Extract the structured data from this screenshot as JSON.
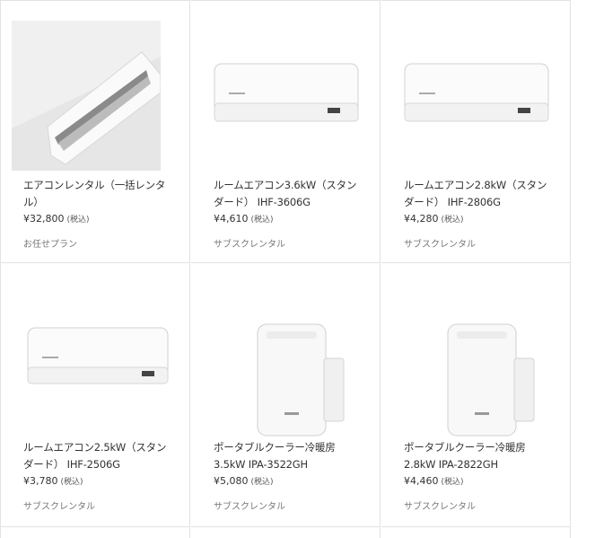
{
  "products": [
    {
      "title": "エアコンレンタル（一括レンタル）",
      "price": "¥32,800",
      "tax": "(税込)",
      "plan": "お任せプラン",
      "icon": "mounted-aircon-photo"
    },
    {
      "title": "ルームエアコン3.6kW（スタンダード） IHF-3606G",
      "price": "¥4,610",
      "tax": "(税込)",
      "plan": "サブスクレンタル",
      "icon": "wall-aircon"
    },
    {
      "title": "ルームエアコン2.8kW（スタンダード） IHF-2806G",
      "price": "¥4,280",
      "tax": "(税込)",
      "plan": "サブスクレンタル",
      "icon": "wall-aircon"
    },
    {
      "title": "ルームエアコン2.5kW（スタンダード） IHF-2506G",
      "price": "¥3,780",
      "tax": "(税込)",
      "plan": "サブスクレンタル",
      "icon": "wall-aircon"
    },
    {
      "title": "ポータブルクーラー冷暖房 3.5kW IPA-3522GH",
      "price": "¥5,080",
      "tax": "(税込)",
      "plan": "サブスクレンタル",
      "icon": "portable-cooler"
    },
    {
      "title": "ポータブルクーラー冷暖房 2.8kW IPA-2822GH",
      "price": "¥4,460",
      "tax": "(税込)",
      "plan": "サブスクレンタル",
      "icon": "portable-cooler"
    }
  ]
}
